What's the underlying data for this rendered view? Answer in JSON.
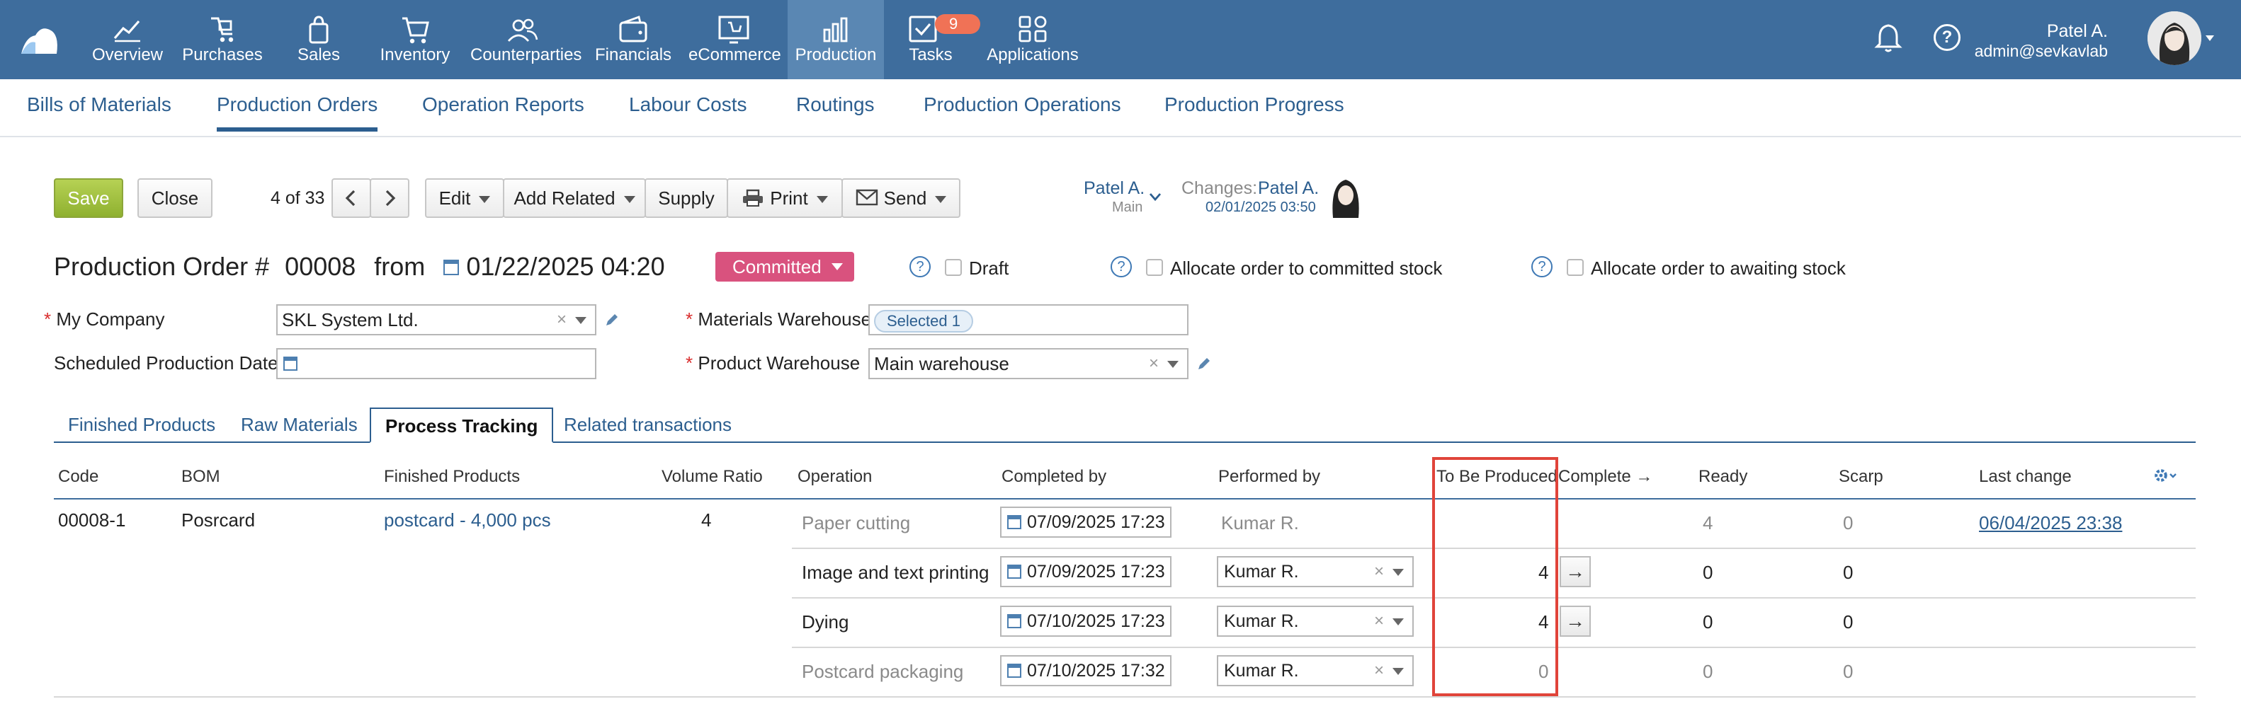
{
  "nav": {
    "items": [
      {
        "label": "Overview"
      },
      {
        "label": "Purchases"
      },
      {
        "label": "Sales"
      },
      {
        "label": "Inventory"
      },
      {
        "label": "Counterparties"
      },
      {
        "label": "Financials"
      },
      {
        "label": "eCommerce"
      },
      {
        "label": "Production"
      },
      {
        "label": "Tasks"
      },
      {
        "label": "Applications"
      }
    ],
    "tasks_badge": "9",
    "user_name": "Patel A.",
    "user_email": "admin@sevkavlab",
    "colors": {
      "bar": "#3e6d9d",
      "active": "#5a87b3",
      "badge": "#f07256"
    }
  },
  "subnav": {
    "items": [
      {
        "label": "Bills of Materials"
      },
      {
        "label": "Production Orders"
      },
      {
        "label": "Operation Reports"
      },
      {
        "label": "Labour Costs"
      },
      {
        "label": "Routings"
      },
      {
        "label": "Production Operations"
      },
      {
        "label": "Production Progress"
      }
    ]
  },
  "toolbar": {
    "save": "Save",
    "close": "Close",
    "pager": "4 of 33",
    "edit": "Edit",
    "add_related": "Add Related",
    "supply": "Supply",
    "print": "Print",
    "send": "Send",
    "owner_name": "Patel A.",
    "owner_sub": "Main",
    "changes_label": "Changes:",
    "changes_user": "Patel A.",
    "changes_date": "02/01/2025 03:50"
  },
  "header": {
    "title_prefix": "Production Order #",
    "number": "00008",
    "from": "from",
    "date": "01/22/2025 04:20",
    "status": "Committed",
    "status_color": "#d9527e",
    "help": "?",
    "draft": "Draft",
    "allocate_committed": "Allocate order to committed stock",
    "allocate_awaiting": "Allocate order to awaiting stock"
  },
  "form": {
    "req": "*",
    "my_company_label": "My Company",
    "my_company_value": "SKL System Ltd.",
    "scheduled_label": "Scheduled Production Date",
    "materials_wh_label": "Materials Warehouse",
    "materials_wh_value": "Selected 1",
    "product_wh_label": "Product Warehouse",
    "product_wh_value": "Main warehouse",
    "clear": "×"
  },
  "tabs": [
    {
      "label": "Finished Products"
    },
    {
      "label": "Raw Materials"
    },
    {
      "label": "Process Tracking"
    },
    {
      "label": "Related transactions"
    }
  ],
  "table": {
    "headers": {
      "code": "Code",
      "bom": "BOM",
      "finished": "Finished Products",
      "ratio": "Volume Ratio",
      "operation": "Operation",
      "completed_by": "Completed by",
      "performed_by": "Performed by",
      "to_be_produced": "To Be Produced",
      "complete": "Complete →",
      "ready": "Ready",
      "scarp": "Scarp",
      "last_change": "Last change"
    },
    "code": "00008-1",
    "bom": "Posrcard",
    "finished": "postcard - 4,000 pcs",
    "ratio": "4",
    "arrow": "→",
    "rows": [
      {
        "operation": "Paper cutting",
        "completed_by": "07/09/2025 17:23",
        "performed_by": "Kumar R.",
        "to_be_produced": "",
        "ready": "4",
        "scarp": "0",
        "last_change": "06/04/2025 23:38"
      },
      {
        "operation": "Image and text printing",
        "completed_by": "07/09/2025 17:23",
        "performed_by": "Kumar R.",
        "to_be_produced": "4",
        "ready": "0",
        "scarp": "0",
        "last_change": ""
      },
      {
        "operation": "Dying",
        "completed_by": "07/10/2025 17:23",
        "performed_by": "Kumar R.",
        "to_be_produced": "4",
        "ready": "0",
        "scarp": "0",
        "last_change": ""
      },
      {
        "operation": "Postcard packaging",
        "completed_by": "07/10/2025 17:32",
        "performed_by": "Kumar R.",
        "to_be_produced": "0",
        "ready": "0",
        "scarp": "0",
        "last_change": ""
      }
    ]
  }
}
